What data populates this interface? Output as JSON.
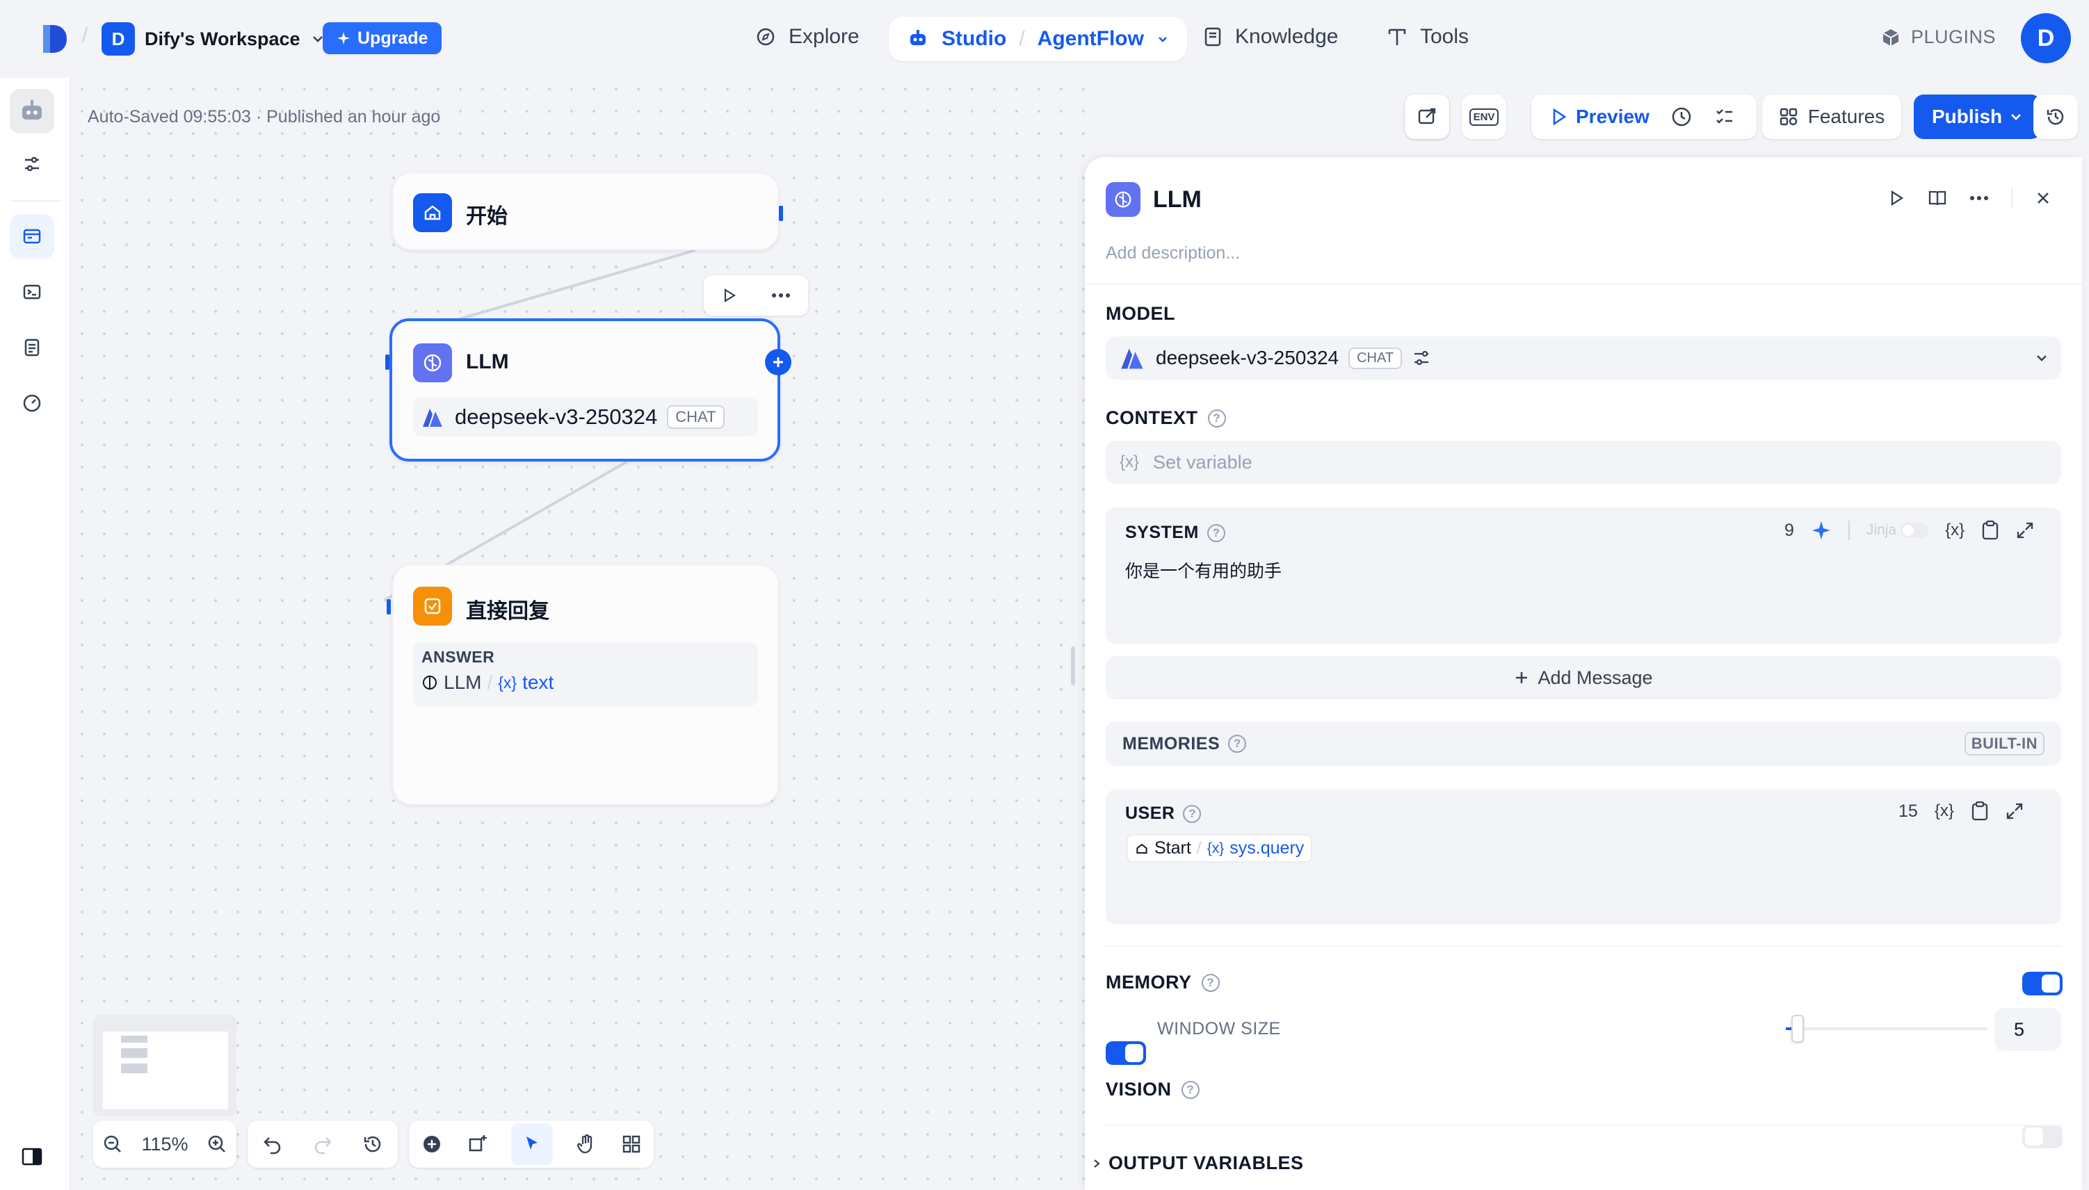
{
  "topbar": {
    "workspace_initial": "D",
    "workspace_name": "Dify's Workspace",
    "upgrade_label": "Upgrade",
    "nav_explore": "Explore",
    "nav_studio": "Studio",
    "nav_app": "AgentFlow",
    "nav_knowledge": "Knowledge",
    "nav_tools": "Tools",
    "plugins_label": "PLUGINS",
    "avatar_initial": "D"
  },
  "canvas": {
    "status": "Auto-Saved 09:55:03 · Published an hour ago",
    "toolbar": {
      "env_label": "ENV",
      "preview_label": "Preview",
      "features_label": "Features",
      "publish_label": "Publish"
    },
    "nodes": {
      "start_title": "开始",
      "llm_title": "LLM",
      "llm_model": "deepseek-v3-250324",
      "llm_model_tag": "CHAT",
      "answer_title": "直接回复",
      "answer_label": "ANSWER",
      "answer_source": "LLM",
      "answer_separator": "/",
      "answer_var_icon": "{x}",
      "answer_var": "text"
    },
    "zoom": "115%"
  },
  "panel": {
    "title": "LLM",
    "description_placeholder": "Add description...",
    "model_label": "MODEL",
    "model_name": "deepseek-v3-250324",
    "model_tag": "CHAT",
    "context_label": "CONTEXT",
    "context_var_icon": "{x}",
    "context_placeholder": "Set variable",
    "system_label": "SYSTEM",
    "system_count": "9",
    "jinja_label": "Jinja",
    "var_icon": "{x}",
    "system_text": "你是一个有用的助手",
    "add_message_label": "Add Message",
    "memories_label": "MEMORIES",
    "builtin_label": "BUILT-IN",
    "user_label": "USER",
    "user_count": "15",
    "user_var_node": "Start",
    "user_var_separator": "/",
    "user_var_icon": "{x}",
    "user_var": "sys.query",
    "memory_label": "MEMORY",
    "window_size_label": "WINDOW SIZE",
    "window_size_value": "5",
    "vision_label": "VISION",
    "output_variables_label": "OUTPUT VARIABLES"
  },
  "colors": {
    "accent": "#155aef",
    "answer_node": "#f79009",
    "llm_node": "#6172f3"
  }
}
